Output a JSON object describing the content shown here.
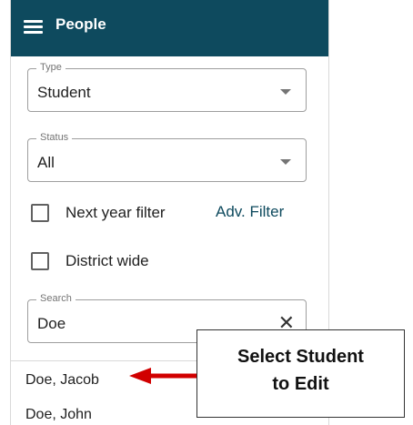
{
  "header": {
    "title": "People"
  },
  "type_select": {
    "label": "Type",
    "value": "Student"
  },
  "status_select": {
    "label": "Status",
    "value": "All"
  },
  "next_year_filter": {
    "label": "Next year filter",
    "checked": false
  },
  "adv_filter": {
    "label": "Adv. Filter"
  },
  "district_wide": {
    "label": "District wide",
    "checked": false
  },
  "search": {
    "label": "Search",
    "value": "Doe"
  },
  "results": [
    {
      "name": "Doe, Jacob"
    },
    {
      "name": "Doe, John"
    }
  ],
  "callout": {
    "line1": "Select Student",
    "line2": "to Edit"
  },
  "colors": {
    "header_bg": "#0e4a5e",
    "arrow": "#d10000"
  },
  "icons": {
    "menu": "menu-icon",
    "caret": "caret-down-icon",
    "clear": "close-icon"
  }
}
